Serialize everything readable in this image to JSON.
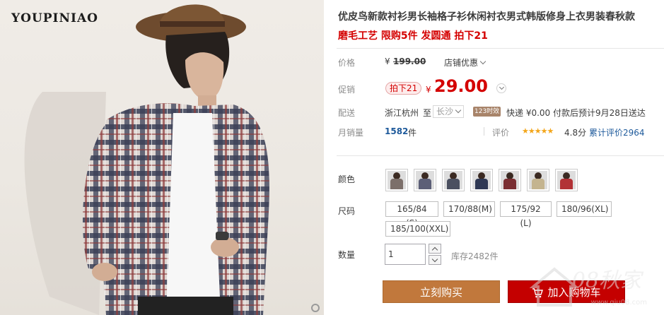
{
  "photo": {
    "brand": "YOUPINIAO"
  },
  "product": {
    "title": "优皮鸟新款衬衫男长袖格子衫休闲衬衣男式韩版修身上衣男装春秋款",
    "subtitle": "磨毛工艺 限购5件 发圆通 拍下21"
  },
  "price_row": {
    "label": "价格",
    "currency": "¥",
    "original": "199.00",
    "store_promo": "店铺优惠"
  },
  "promo_row": {
    "label": "促销",
    "badge": "拍下21",
    "currency": "¥",
    "price": "29.00"
  },
  "shipping": {
    "label": "配送",
    "from": "浙江杭州",
    "to_word": "至",
    "city": "长沙",
    "tag": "123时效",
    "detail": "快递 ¥0.00 付款后预计9月28日送达"
  },
  "sales": {
    "label": "月销量",
    "count": "1582",
    "unit": "件",
    "rating_label": "评价",
    "stars": "★★★★★",
    "score": "4.8分",
    "reviews": "累计评价2964"
  },
  "color": {
    "label": "颜色",
    "swatches": [
      {
        "name": "swatch-1",
        "color": "#7c6f6a"
      },
      {
        "name": "swatch-2",
        "color": "#5c5f77"
      },
      {
        "name": "swatch-3",
        "color": "#4b5060"
      },
      {
        "name": "swatch-4",
        "color": "#2f3854"
      },
      {
        "name": "swatch-5",
        "color": "#7b2f33"
      },
      {
        "name": "swatch-6",
        "color": "#c4b48f"
      },
      {
        "name": "swatch-7",
        "color": "#b23236"
      }
    ]
  },
  "size": {
    "label": "尺码",
    "options": [
      "165/84 (S)",
      "170/88(M)",
      "175/92 (L)",
      "180/96(XL)",
      "185/100(XXL)"
    ]
  },
  "quantity": {
    "label": "数量",
    "value": "1",
    "stock": "库存2482件"
  },
  "actions": {
    "buy_now": "立刻购买",
    "add_to_cart": "加入购物车"
  },
  "colors": {
    "accent_red": "#c40000",
    "buy_button": "#c1783c"
  },
  "watermark": {
    "text": "08秋家",
    "url": "www.qiu08.com"
  }
}
